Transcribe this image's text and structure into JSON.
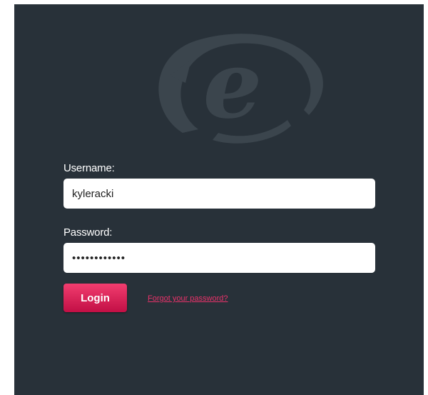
{
  "brand": {
    "logo_icon": "e-swirl-logo",
    "logo_color": "#3b454d",
    "background_color": "#283139",
    "accent_color": "#e8326a"
  },
  "login_form": {
    "username_label": "Username:",
    "username_value": "kyleracki",
    "password_label": "Password:",
    "password_value": "••••••••••••",
    "login_label": "Login",
    "forgot_label": "Forgot your password?"
  }
}
